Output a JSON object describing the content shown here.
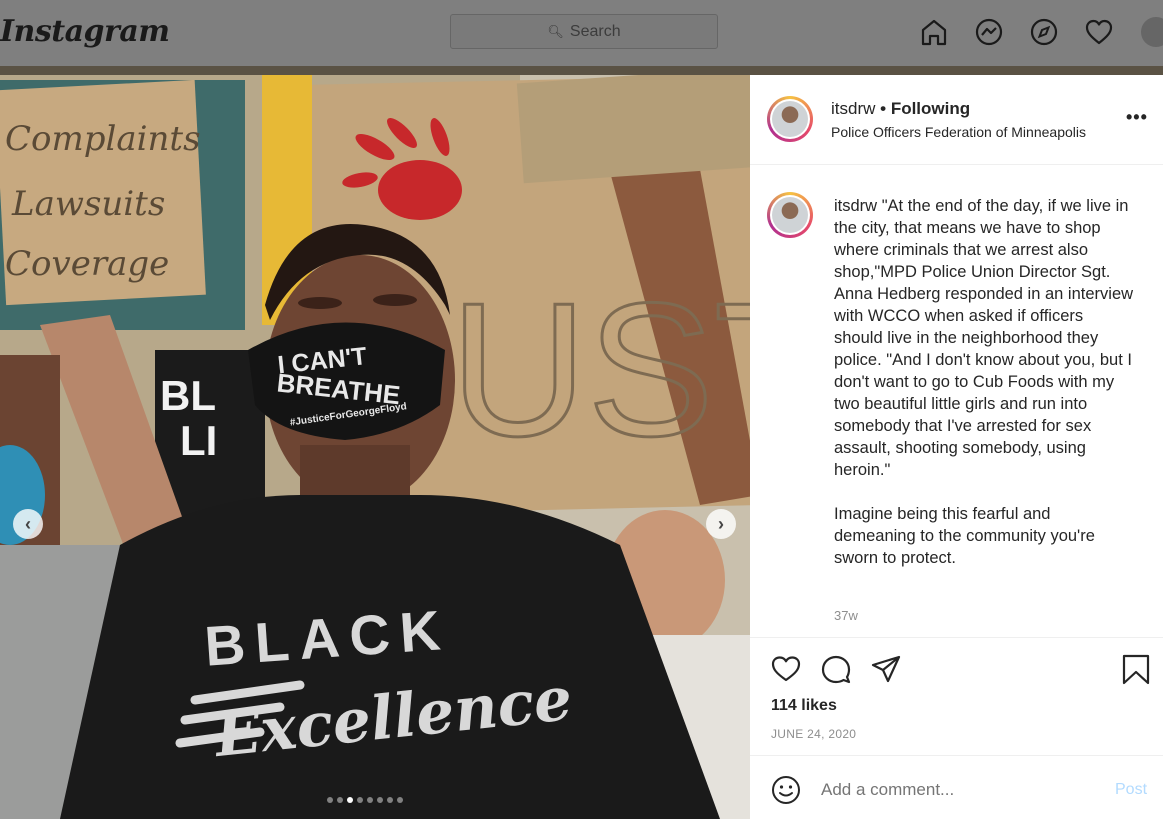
{
  "topbar": {
    "logo": "Instagram",
    "search_placeholder": "Search"
  },
  "post": {
    "image_text": {
      "sign_top_left": [
        "Complaints",
        "Lawsuits",
        "Coverage"
      ],
      "sign_black": "BL LI MA",
      "mask_line1": "I CAN'T",
      "mask_line2": "BREATHE",
      "mask_line3": "#JusticeForGeorgeFloyd",
      "shirt_line1": "BLACK",
      "shirt_line2": "Excellence",
      "sign_right": "MUST GO"
    },
    "carousel": {
      "total": 8,
      "active": 2
    },
    "header": {
      "username": "itsdrw",
      "follow_status": "• Following",
      "location": "Police Officers Federation of Minneapolis",
      "more": "•••"
    },
    "caption": {
      "username": "itsdrw",
      "paragraph1": "\"At the end of the day, if we live in the city, that means we have to shop where criminals that we arrest also shop,\"MPD Police Union Director Sgt. Anna Hedberg responded in an interview with WCCO when asked if officers should live in the neighborhood they police. \"And I don't know about you, but I don't want to go to Cub Foods with my two beautiful little girls and run into somebody that I've arrested for sex assault, shooting somebody, using heroin.\"",
      "paragraph2": "Imagine being this fearful and demeaning to the community you're sworn to protect.",
      "age": "37w"
    },
    "likes": "114 likes",
    "date": "JUNE 24, 2020",
    "comment": {
      "placeholder": "Add a comment...",
      "post_label": "Post"
    }
  },
  "colors": {
    "accent_post": "#b3dbff",
    "text": "#262626",
    "muted": "#8e8e8e"
  }
}
